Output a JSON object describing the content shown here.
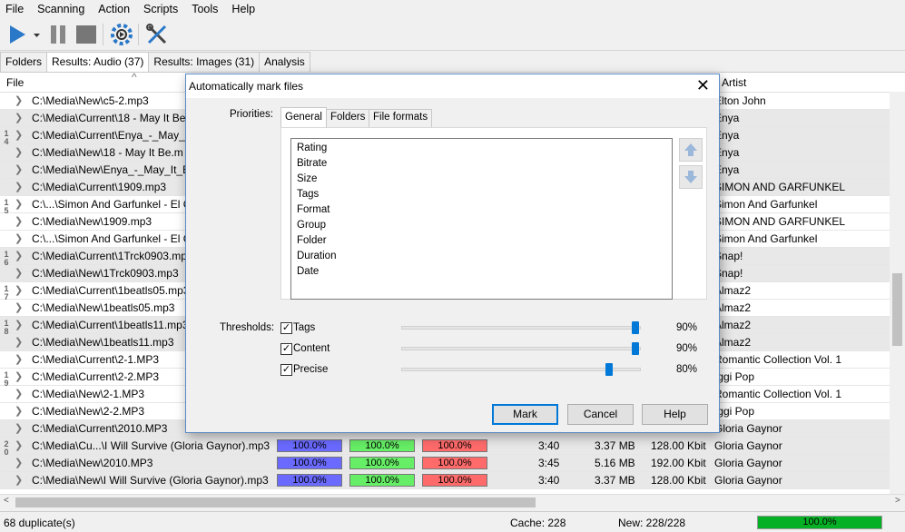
{
  "menu": [
    "File",
    "Scanning",
    "Action",
    "Scripts",
    "Tools",
    "Help"
  ],
  "tabs": [
    {
      "label": "Folders"
    },
    {
      "label": "Results: Audio (37)"
    },
    {
      "label": "Results: Images (31)"
    },
    {
      "label": "Analysis"
    }
  ],
  "columns": {
    "file": "File",
    "artist": "Artist"
  },
  "rows": [
    {
      "file": "C:\\Media\\New\\c5-2.mp3",
      "artist": "Elton John",
      "g": false
    },
    {
      "file": "C:\\Media\\Current\\18 - May It Be",
      "artist": "Enya",
      "g": true
    },
    {
      "file": "C:\\Media\\Current\\Enya_-_May_I",
      "artist": "Enya",
      "g": true
    },
    {
      "file": "C:\\Media\\New\\18 - May It Be.m",
      "artist": "Enya",
      "g": true
    },
    {
      "file": "C:\\Media\\New\\Enya_-_May_It_B",
      "artist": "Enya",
      "g": true
    },
    {
      "file": "C:\\Media\\Current\\1909.mp3",
      "artist": "SIMON AND GARFUNKEL",
      "g": true
    },
    {
      "file": "C:\\...\\Simon And Garfunkel - El C",
      "artist": "Simon And Garfunkel",
      "g": false
    },
    {
      "file": "C:\\Media\\New\\1909.mp3",
      "artist": "SIMON AND GARFUNKEL",
      "g": false
    },
    {
      "file": "C:\\...\\Simon And Garfunkel - El C",
      "artist": "Simon And Garfunkel",
      "g": false
    },
    {
      "file": "C:\\Media\\Current\\1Trck0903.mp3",
      "artist": "Snap!",
      "g": true
    },
    {
      "file": "C:\\Media\\New\\1Trck0903.mp3",
      "artist": "Snap!",
      "g": true
    },
    {
      "file": "C:\\Media\\Current\\1beatls05.mp3",
      "artist": "Almaz2",
      "g": false
    },
    {
      "file": "C:\\Media\\New\\1beatls05.mp3",
      "artist": "Almaz2",
      "g": false
    },
    {
      "file": "C:\\Media\\Current\\1beatls11.mp3",
      "artist": "Almaz2",
      "g": true
    },
    {
      "file": "C:\\Media\\New\\1beatls11.mp3",
      "artist": "Almaz2",
      "g": true
    },
    {
      "file": "C:\\Media\\Current\\2-1.MP3",
      "artist": "Romantic Collection Vol. 1",
      "g": false
    },
    {
      "file": "C:\\Media\\Current\\2-2.MP3",
      "artist": "Iggi Pop",
      "g": false
    },
    {
      "file": "C:\\Media\\New\\2-1.MP3",
      "artist": "Romantic Collection Vol. 1",
      "g": false
    },
    {
      "file": "C:\\Media\\New\\2-2.MP3",
      "artist": "Iggi Pop",
      "g": false
    },
    {
      "file": "C:\\Media\\Current\\2010.MP3",
      "artist": "Gloria Gaynor",
      "g": true
    },
    {
      "file": "C:\\Media\\Cu...\\I Will Survive (Gloria Gaynor).mp3",
      "artist": "Gloria Gaynor",
      "g": true,
      "p1": "100.0%",
      "p2": "100.0%",
      "p3": "100.0%",
      "dur": "3:40",
      "size": "3.37 MB",
      "br": "128.00 Kbit"
    },
    {
      "file": "C:\\Media\\New\\2010.MP3",
      "artist": "Gloria Gaynor",
      "g": true,
      "p1": "100.0%",
      "p2": "100.0%",
      "p3": "100.0%",
      "dur": "3:45",
      "size": "5.16 MB",
      "br": "192.00 Kbit"
    },
    {
      "file": "C:\\Media\\New\\I Will Survive (Gloria Gaynor).mp3",
      "artist": "Gloria Gaynor",
      "g": true,
      "p1": "100.0%",
      "p2": "100.0%",
      "p3": "100.0%",
      "dur": "3:40",
      "size": "3.37 MB",
      "br": "128.00 Kbit"
    }
  ],
  "groups": [
    "1 4",
    "1 5",
    "1 6",
    "1 7",
    "1 8",
    "1 9",
    "2 0"
  ],
  "status": {
    "duplicates": "68 duplicate(s)",
    "cache": "Cache: 228",
    "new": "New: 228/228",
    "progress": "100.0%"
  },
  "dialog": {
    "title": "Automatically mark files",
    "priorities_label": "Priorities:",
    "tabs": [
      "General",
      "Folders",
      "File formats"
    ],
    "priority_items": [
      "Rating",
      "Bitrate",
      "Size",
      "Tags",
      "Format",
      "Group",
      "Folder",
      "Duration",
      "Date"
    ],
    "thresholds_label": "Thresholds:",
    "thresholds": [
      {
        "label": "Tags",
        "value": "90%",
        "level": 0.9
      },
      {
        "label": "Content",
        "value": "90%",
        "level": 0.9
      },
      {
        "label": "Precise",
        "value": "80%",
        "level": 0.8
      }
    ],
    "buttons": {
      "mark": "Mark",
      "cancel": "Cancel",
      "help": "Help"
    }
  },
  "colors": {
    "blue": "#6a6aff",
    "green": "#66ee66",
    "red": "#ff6b6b",
    "accent": "#0078d7"
  }
}
